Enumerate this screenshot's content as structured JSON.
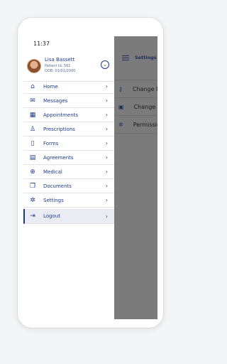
{
  "status_bar": {
    "time": "11:37"
  },
  "profile": {
    "name": "Lisa Bassett",
    "patient_id": "Patient Id: 561",
    "dob": "DOB: 01/01/2000",
    "toggle_icon": "chevron-down-icon"
  },
  "menu": [
    {
      "label": "Home",
      "icon": "home-icon"
    },
    {
      "label": "Messages",
      "icon": "envelope-icon"
    },
    {
      "label": "Appointments",
      "icon": "calendar-icon"
    },
    {
      "label": "Prescriptions",
      "icon": "doctor-icon"
    },
    {
      "label": "Forms",
      "icon": "document-icon"
    },
    {
      "label": "Agreements",
      "icon": "contract-icon"
    },
    {
      "label": "Medical",
      "icon": "medical-bag-icon"
    },
    {
      "label": "Documents",
      "icon": "folder-icon"
    },
    {
      "label": "Settings",
      "icon": "gear-icon"
    }
  ],
  "logout": {
    "label": "Logout",
    "icon": "logout-icon"
  },
  "background_screen": {
    "title": "Settings",
    "items": [
      {
        "label": "Change P",
        "icon": "key-icon"
      },
      {
        "label": "Change S",
        "icon": "lock-icon"
      },
      {
        "label": "Permissio",
        "icon": "gear-icon"
      }
    ]
  },
  "colors": {
    "accent": "#1d3a8a",
    "overlay": "#7b7b7b",
    "selected_bg": "#e9edf3"
  }
}
